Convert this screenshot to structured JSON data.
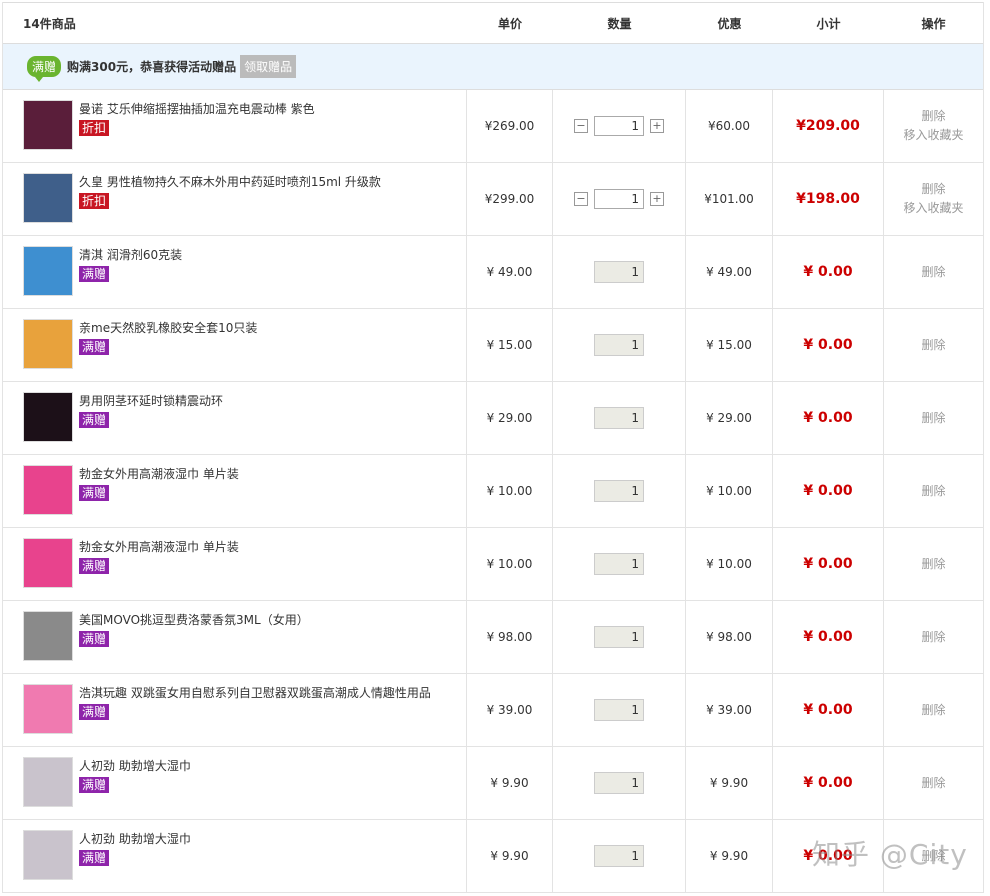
{
  "header": {
    "col_name": "14件商品",
    "col_price": "单价",
    "col_qty": "数量",
    "col_discount": "优惠",
    "col_subtotal": "小计",
    "col_ops": "操作"
  },
  "promo": {
    "tag": "满赠",
    "message": "购满300元，恭喜获得活动赠品",
    "button": "领取赠品"
  },
  "items": [
    {
      "name": "曼诺 艾乐伸缩摇摆抽插加温充电震动棒 紫色",
      "label": "折扣",
      "label_type": "zk",
      "price": "¥269.00",
      "qty": "1",
      "editable": true,
      "discount": "¥60.00",
      "subtotal": "¥209.00",
      "op1": "删除",
      "op2": "移入收藏夹",
      "thumb_color": "#5a1e3a"
    },
    {
      "name": "久皇 男性植物持久不麻木外用中药延时喷剂15ml 升级款",
      "label": "折扣",
      "label_type": "zk",
      "price": "¥299.00",
      "qty": "1",
      "editable": true,
      "discount": "¥101.00",
      "subtotal": "¥198.00",
      "op1": "删除",
      "op2": "移入收藏夹",
      "thumb_color": "#3f5f8a"
    },
    {
      "name": "清淇 润滑剂60克装",
      "label": "满赠",
      "label_type": "mz",
      "price": "¥ 49.00",
      "qty": "1",
      "editable": false,
      "discount": "¥ 49.00",
      "subtotal": "¥ 0.00",
      "op1": "删除",
      "op2": "",
      "thumb_color": "#3e8fd0"
    },
    {
      "name": "亲me天然胶乳橡胶安全套10只装",
      "label": "满赠",
      "label_type": "mz",
      "price": "¥ 15.00",
      "qty": "1",
      "editable": false,
      "discount": "¥ 15.00",
      "subtotal": "¥ 0.00",
      "op1": "删除",
      "op2": "",
      "thumb_color": "#e8a23c"
    },
    {
      "name": "男用阴茎环延时锁精震动环",
      "label": "满赠",
      "label_type": "mz",
      "price": "¥ 29.00",
      "qty": "1",
      "editable": false,
      "discount": "¥ 29.00",
      "subtotal": "¥ 0.00",
      "op1": "删除",
      "op2": "",
      "thumb_color": "#1c1018"
    },
    {
      "name": "勃金女外用高潮液湿巾 单片装",
      "label": "满赠",
      "label_type": "mz",
      "price": "¥ 10.00",
      "qty": "1",
      "editable": false,
      "discount": "¥ 10.00",
      "subtotal": "¥ 0.00",
      "op1": "删除",
      "op2": "",
      "thumb_color": "#e8438d"
    },
    {
      "name": "勃金女外用高潮液湿巾 单片装",
      "label": "满赠",
      "label_type": "mz",
      "price": "¥ 10.00",
      "qty": "1",
      "editable": false,
      "discount": "¥ 10.00",
      "subtotal": "¥ 0.00",
      "op1": "删除",
      "op2": "",
      "thumb_color": "#e8438d"
    },
    {
      "name": "美国MOVO挑逗型费洛蒙香氛3ML（女用）",
      "label": "满赠",
      "label_type": "mz",
      "price": "¥ 98.00",
      "qty": "1",
      "editable": false,
      "discount": "¥ 98.00",
      "subtotal": "¥ 0.00",
      "op1": "删除",
      "op2": "",
      "thumb_color": "#8a8a8a"
    },
    {
      "name": "浩淇玩趣 双跳蛋女用自慰系列自卫慰器双跳蛋高潮成人情趣性用品",
      "label": "满赠",
      "label_type": "mz",
      "price": "¥ 39.00",
      "qty": "1",
      "editable": false,
      "discount": "¥ 39.00",
      "subtotal": "¥ 0.00",
      "op1": "删除",
      "op2": "",
      "thumb_color": "#f07ab0"
    },
    {
      "name": "人初劲 助勃增大湿巾",
      "label": "满赠",
      "label_type": "mz",
      "price": "¥ 9.90",
      "qty": "1",
      "editable": false,
      "discount": "¥ 9.90",
      "subtotal": "¥ 0.00",
      "op1": "删除",
      "op2": "",
      "thumb_color": "#c9c3cc"
    },
    {
      "name": "人初劲 助勃增大湿巾",
      "label": "满赠",
      "label_type": "mz",
      "price": "¥ 9.90",
      "qty": "1",
      "editable": false,
      "discount": "¥ 9.90",
      "subtotal": "¥ 0.00",
      "op1": "删除",
      "op2": "",
      "thumb_color": "#c9c3cc"
    }
  ],
  "watermark": "知乎 @City"
}
